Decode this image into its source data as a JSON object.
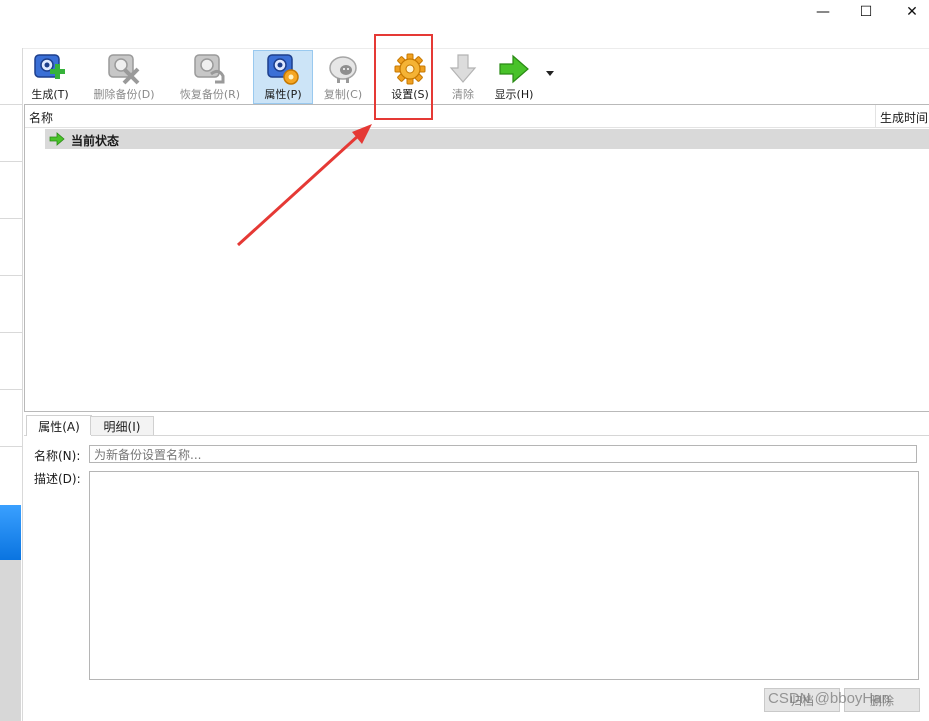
{
  "window": {
    "minimize_glyph": "—",
    "maximize_glyph": "☐",
    "close_glyph": "✕"
  },
  "toolbar": {
    "items": [
      {
        "label": "生成(T)",
        "icon": "camera-add-icon",
        "state": "enabled"
      },
      {
        "label": "删除备份(D)",
        "icon": "camera-delete-icon",
        "state": "disabled"
      },
      {
        "label": "恢复备份(R)",
        "icon": "camera-restore-icon",
        "state": "disabled"
      },
      {
        "label": "属性(P)",
        "icon": "camera-properties-icon",
        "state": "active"
      },
      {
        "label": "复制(C)",
        "icon": "sheep-clone-icon",
        "state": "disabled"
      },
      {
        "label": "设置(S)",
        "icon": "gear-icon",
        "state": "enabled"
      },
      {
        "label": "清除",
        "icon": "down-arrow-icon",
        "state": "disabled"
      },
      {
        "label": "显示(H)",
        "icon": "right-arrow-icon",
        "state": "enabled"
      }
    ]
  },
  "list": {
    "columns": [
      "名称",
      "生成时间"
    ],
    "rows": [
      {
        "label": "当前状态",
        "icon": "right-arrow-icon"
      }
    ]
  },
  "tabs": [
    "属性(A)",
    "明细(I)"
  ],
  "form": {
    "name_label": "名称(N):",
    "name_placeholder": "为新备份设置名称...",
    "desc_label": "描述(D):"
  },
  "bottom": {
    "buttons": [
      "归档",
      "删除"
    ],
    "watermark": "CSDN @bboyHan"
  },
  "colors": {
    "accent_active": "#cce4f7",
    "highlight_red": "#e53935",
    "row_selected": "#d9d9d9",
    "left_accent": "#0a74e0"
  }
}
